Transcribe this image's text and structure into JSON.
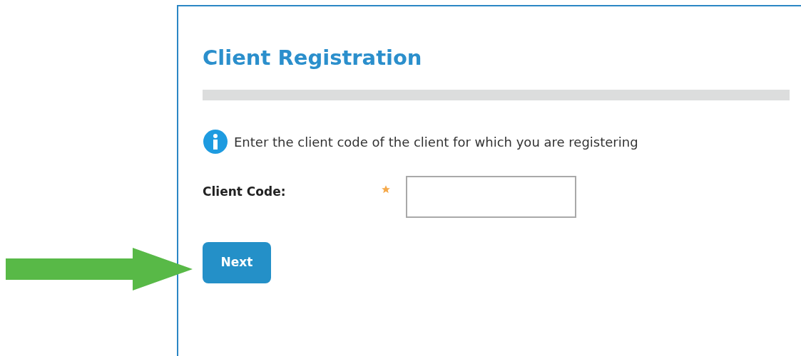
{
  "form": {
    "title": "Client Registration",
    "info": "Enter the client code of the client for which you are registering",
    "field": {
      "label": "Client Code:",
      "required": true
    },
    "button": "Next"
  },
  "annotation": {
    "kind": "arrow"
  }
}
